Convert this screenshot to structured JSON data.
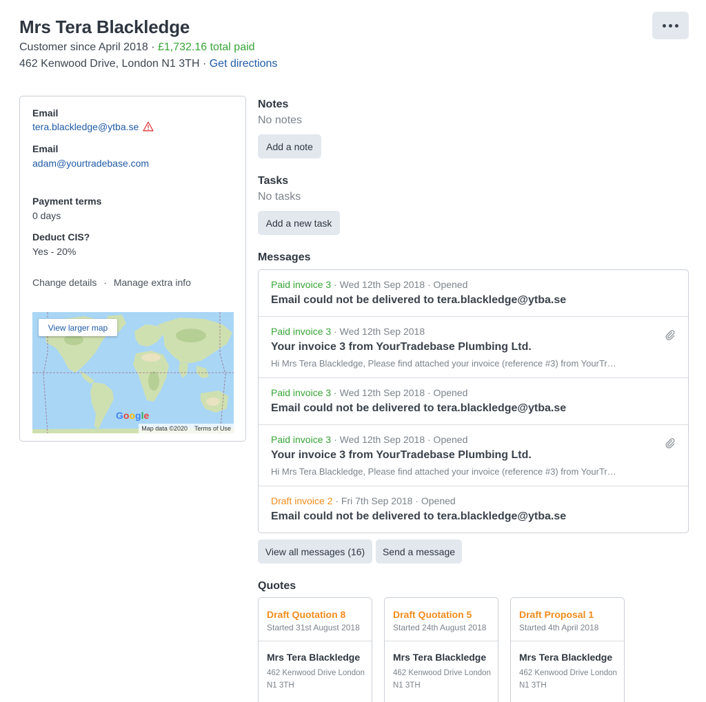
{
  "customer": {
    "name": "Mrs Tera Blackledge",
    "since": "Customer since April 2018",
    "separator": " · ",
    "total_paid": "£1,732.16 total paid",
    "address": "462 Kenwood Drive, London N1 3TH",
    "directions_link": "Get directions"
  },
  "more_button": {
    "icon": "ellipsis-icon"
  },
  "details": {
    "email1_label": "Email",
    "email1_value": "tera.blackledge@ytba.se",
    "email1_warning_icon": "warning-icon",
    "email2_label": "Email",
    "email2_value": "adam@yourtradebase.com",
    "payment_terms_label": "Payment terms",
    "payment_terms_value": "0 days",
    "cis_label": "Deduct CIS?",
    "cis_value": "Yes - 20%",
    "change_details": "Change details",
    "links_separator": "·",
    "manage_extra": "Manage extra info"
  },
  "map": {
    "larger_map": "View larger map",
    "logo_letters": [
      "G",
      "o",
      "o",
      "g",
      "l",
      "e"
    ],
    "logo_colors": [
      "#4285f4",
      "#ea4335",
      "#fbbc05",
      "#4285f4",
      "#34a853",
      "#ea4335"
    ],
    "map_data": "Map data ©2020",
    "terms": "Terms of Use"
  },
  "notes": {
    "heading": "Notes",
    "empty": "No notes",
    "add_button": "Add a note"
  },
  "tasks": {
    "heading": "Tasks",
    "empty": "No tasks",
    "add_button": "Add a new task"
  },
  "messages": {
    "heading": "Messages",
    "items": [
      {
        "doc": "Paid invoice 3",
        "doc_status": "paid",
        "meta": " · Wed 12th Sep 2018 · Opened",
        "subject": "Email could not be delivered to tera.blackledge@ytba.se",
        "preview": "",
        "attachment": false
      },
      {
        "doc": "Paid invoice 3",
        "doc_status": "paid",
        "meta": " · Wed 12th Sep 2018",
        "subject": "Your invoice 3 from YourTradebase Plumbing Ltd.",
        "preview": "Hi Mrs Tera Blackledge, Please find attached your invoice (reference #3) from YourTr…",
        "attachment": true
      },
      {
        "doc": "Paid invoice 3",
        "doc_status": "paid",
        "meta": " · Wed 12th Sep 2018 · Opened",
        "subject": "Email could not be delivered to tera.blackledge@ytba.se",
        "preview": "",
        "attachment": false
      },
      {
        "doc": "Paid invoice 3",
        "doc_status": "paid",
        "meta": " · Wed 12th Sep 2018 · Opened",
        "subject": "Your invoice 3 from YourTradebase Plumbing Ltd.",
        "preview": "Hi Mrs Tera Blackledge, Please find attached your invoice (reference #3) from YourTr…",
        "attachment": true
      },
      {
        "doc": "Draft invoice 2",
        "doc_status": "draft",
        "meta": " · Fri 7th Sep 2018 · Opened",
        "subject": "Email could not be delivered to tera.blackledge@ytba.se",
        "preview": "",
        "attachment": false
      }
    ],
    "view_all_button": "View all messages (16)",
    "send_button": "Send a message"
  },
  "quotes": {
    "heading": "Quotes",
    "items": [
      {
        "title": "Draft Quotation 8",
        "started": "Started 31st August 2018",
        "customer": "Mrs Tera Blackledge",
        "address": "462 Kenwood Drive London N1 3TH"
      },
      {
        "title": "Draft Quotation 5",
        "started": "Started 24th August 2018",
        "customer": "Mrs Tera Blackledge",
        "address": "462 Kenwood Drive London N1 3TH"
      },
      {
        "title": "Draft Proposal 1",
        "started": "Started 4th April 2018",
        "customer": "Mrs Tera Blackledge",
        "address": "462 Kenwood Drive London N1 3TH"
      }
    ]
  },
  "colors": {
    "paid": "#36a436",
    "draft": "#f08c1c",
    "link": "#1f5aa6",
    "button_bg": "#e3e8ef",
    "warning": "#e03a3a"
  }
}
